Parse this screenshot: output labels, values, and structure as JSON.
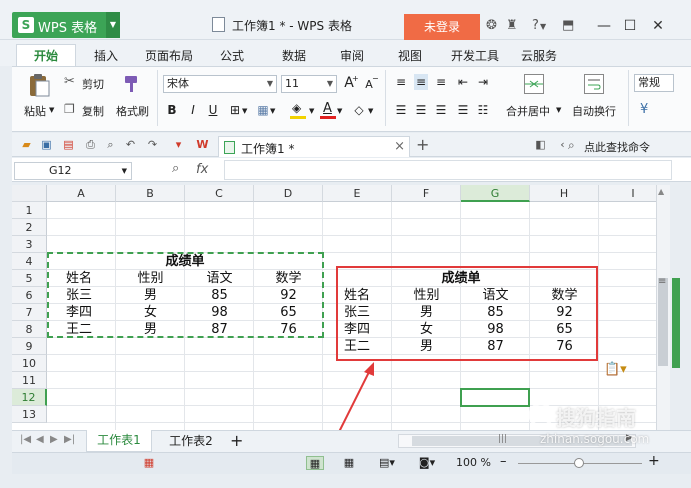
{
  "app": {
    "name": "WPS 表格",
    "logo": "S",
    "document_title": "工作簿1 * - WPS 表格",
    "login_label": "未登录",
    "title_icons": [
      "skin-icon",
      "shirt-icon",
      "help-icon",
      "collapse-icon"
    ],
    "help_label": "?",
    "window_controls": [
      "minimize",
      "maximize",
      "close"
    ]
  },
  "menu": {
    "tabs": [
      "开始",
      "插入",
      "页面布局",
      "公式",
      "数据",
      "审阅",
      "视图",
      "开发工具",
      "云服务"
    ],
    "active": "开始"
  },
  "ribbon": {
    "paste_label": "粘贴",
    "cut_label": "剪切",
    "copy_label": "复制",
    "format_painter_label": "格式刷",
    "font_name": "宋体",
    "font_size": "11",
    "bold": "B",
    "italic": "I",
    "underline": "U",
    "merge_center_label": "合并居中",
    "wrap_text_label": "自动换行",
    "number_format": "常规",
    "grow_font": "A",
    "shrink_font": "A",
    "font_color_glyph": "A"
  },
  "quick_access": {
    "doc_tab_label": "工作簿1 *",
    "find_command_label": "点此查找命令"
  },
  "formula_bar": {
    "name_box": "G12",
    "fx_label": "fx",
    "formula": ""
  },
  "grid": {
    "columns": [
      "A",
      "B",
      "C",
      "D",
      "E",
      "F",
      "G",
      "H",
      "I"
    ],
    "rows": [
      "1",
      "2",
      "3",
      "4",
      "5",
      "6",
      "7",
      "8",
      "9",
      "10",
      "11",
      "12",
      "13"
    ],
    "selected_column": "G",
    "selected_row": "12",
    "table_title": "成绩单",
    "headers": [
      "姓名",
      "性别",
      "语文",
      "数学"
    ],
    "records": [
      [
        "张三",
        "男",
        "85",
        "92"
      ],
      [
        "李四",
        "女",
        "98",
        "65"
      ],
      [
        "王二",
        "男",
        "87",
        "76"
      ]
    ]
  },
  "sheets": {
    "tabs": [
      "工作表1",
      "工作表2"
    ],
    "active": "工作表1",
    "add_label": "+"
  },
  "statusbar": {
    "zoom_label": "100 %",
    "zoom_minus": "–",
    "zoom_plus": "+",
    "zoom_level": 1.0
  },
  "watermark": {
    "text": "搜狗指南",
    "url": "zhinan.sogou.com"
  },
  "colors": {
    "accent_green": "#3ca456",
    "login_orange": "#f06b45",
    "highlight_red": "#e13a3a"
  }
}
